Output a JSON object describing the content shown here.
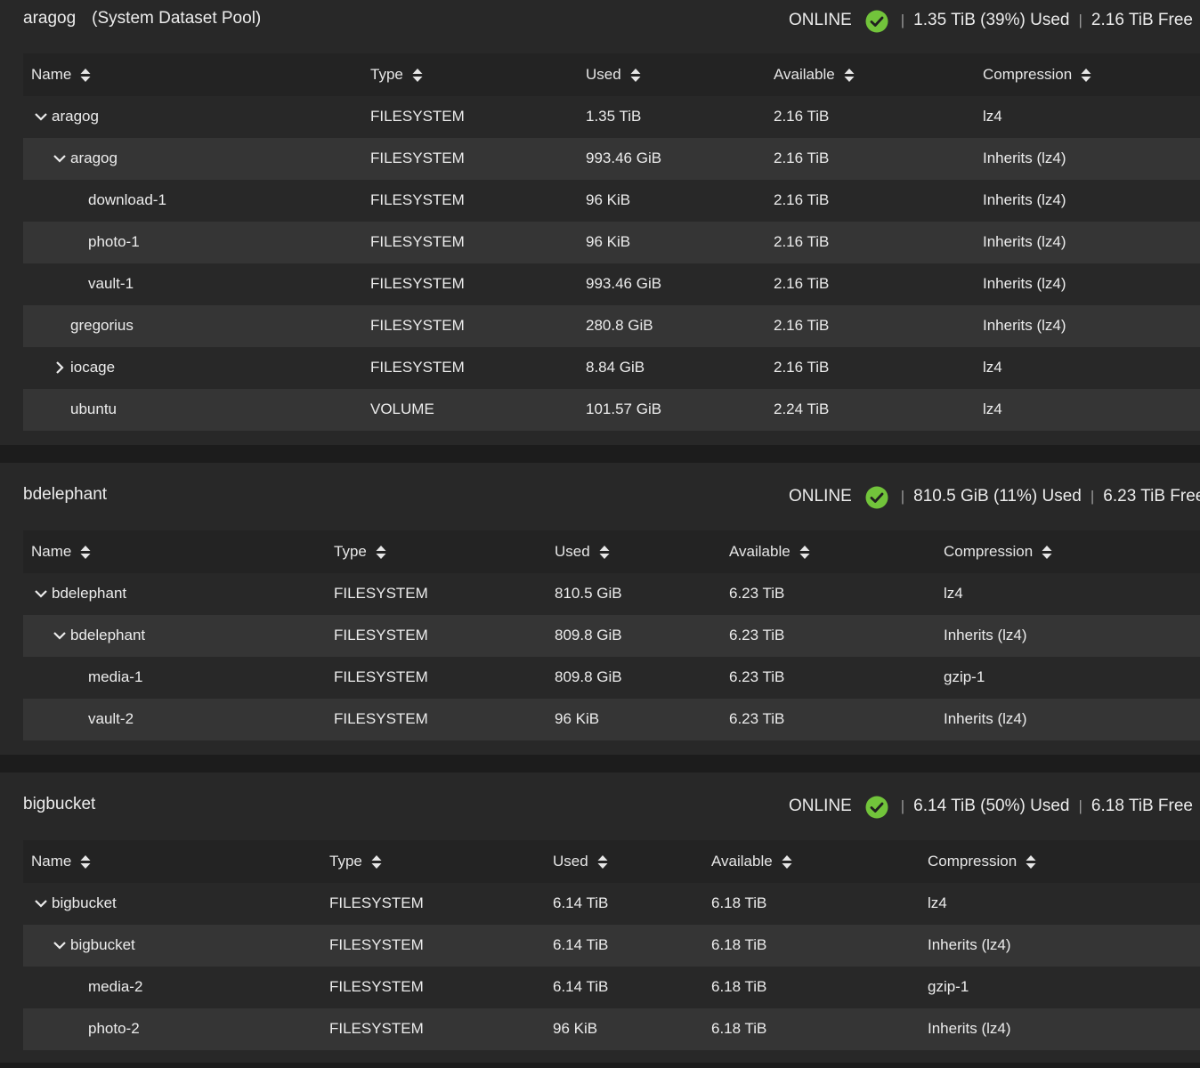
{
  "columns": [
    "Name",
    "Type",
    "Used",
    "Available",
    "Compression"
  ],
  "pools": [
    {
      "name": "aragog",
      "subtitle": "(System Dataset Pool)",
      "status": "ONLINE",
      "used": "1.35 TiB (39%) Used",
      "free": "2.16 TiB Free",
      "rows": [
        {
          "name": "aragog",
          "toggle": "expanded",
          "type": "FILESYSTEM",
          "used": "1.35 TiB",
          "available": "2.16 TiB",
          "compression": "lz4"
        },
        {
          "name": "aragog",
          "toggle": "expanded",
          "type": "FILESYSTEM",
          "used": "993.46 GiB",
          "available": "2.16 TiB",
          "compression": "Inherits (lz4)"
        },
        {
          "name": "download-1",
          "toggle": "none",
          "type": "FILESYSTEM",
          "used": "96 KiB",
          "available": "2.16 TiB",
          "compression": "Inherits (lz4)"
        },
        {
          "name": "photo-1",
          "toggle": "none",
          "type": "FILESYSTEM",
          "used": "96 KiB",
          "available": "2.16 TiB",
          "compression": "Inherits (lz4)"
        },
        {
          "name": "vault-1",
          "toggle": "none",
          "type": "FILESYSTEM",
          "used": "993.46 GiB",
          "available": "2.16 TiB",
          "compression": "Inherits (lz4)"
        },
        {
          "name": "gregorius",
          "toggle": "none",
          "type": "FILESYSTEM",
          "used": "280.8 GiB",
          "available": "2.16 TiB",
          "compression": "Inherits (lz4)"
        },
        {
          "name": "iocage",
          "toggle": "collapsed",
          "type": "FILESYSTEM",
          "used": "8.84 GiB",
          "available": "2.16 TiB",
          "compression": "lz4"
        },
        {
          "name": "ubuntu",
          "toggle": "none",
          "type": "VOLUME",
          "used": "101.57 GiB",
          "available": "2.24 TiB",
          "compression": "lz4"
        }
      ]
    },
    {
      "name": "bdelephant",
      "subtitle": "",
      "status": "ONLINE",
      "used": "810.5 GiB (11%) Used",
      "free": "6.23 TiB Free",
      "rows": [
        {
          "name": "bdelephant",
          "toggle": "expanded",
          "type": "FILESYSTEM",
          "used": "810.5 GiB",
          "available": "6.23 TiB",
          "compression": "lz4"
        },
        {
          "name": "bdelephant",
          "toggle": "expanded",
          "type": "FILESYSTEM",
          "used": "809.8 GiB",
          "available": "6.23 TiB",
          "compression": "Inherits (lz4)"
        },
        {
          "name": "media-1",
          "toggle": "none",
          "type": "FILESYSTEM",
          "used": "809.8 GiB",
          "available": "6.23 TiB",
          "compression": "gzip-1"
        },
        {
          "name": "vault-2",
          "toggle": "none",
          "type": "FILESYSTEM",
          "used": "96 KiB",
          "available": "6.23 TiB",
          "compression": "Inherits (lz4)"
        }
      ]
    },
    {
      "name": "bigbucket",
      "subtitle": "",
      "status": "ONLINE",
      "used": "6.14 TiB (50%) Used",
      "free": "6.18 TiB Free",
      "rows": [
        {
          "name": "bigbucket",
          "toggle": "expanded",
          "type": "FILESYSTEM",
          "used": "6.14 TiB",
          "available": "6.18 TiB",
          "compression": "lz4"
        },
        {
          "name": "bigbucket",
          "toggle": "expanded",
          "type": "FILESYSTEM",
          "used": "6.14 TiB",
          "available": "6.18 TiB",
          "compression": "Inherits (lz4)"
        },
        {
          "name": "media-2",
          "toggle": "none",
          "type": "FILESYSTEM",
          "used": "6.14 TiB",
          "available": "6.18 TiB",
          "compression": "gzip-1"
        },
        {
          "name": "photo-2",
          "toggle": "none",
          "type": "FILESYSTEM",
          "used": "96 KiB",
          "available": "6.18 TiB",
          "compression": "Inherits (lz4)"
        }
      ]
    }
  ],
  "colors": {
    "background": "#1f1f1f",
    "card": "#282828",
    "row_alt": "#353535",
    "status_ok": "#72c43b",
    "text": "#ececec"
  },
  "icons": {
    "status": "check-circle-icon",
    "sort": "sort-icon",
    "expanded": "chevron-down-icon",
    "collapsed": "chevron-right-icon"
  }
}
